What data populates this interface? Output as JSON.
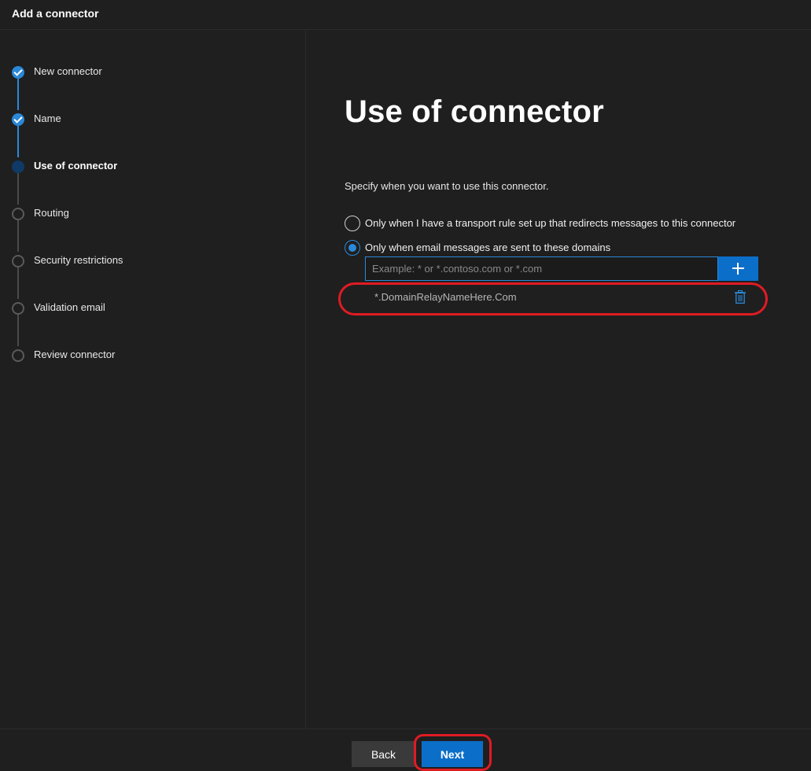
{
  "window": {
    "title": "Add a connector"
  },
  "steps": [
    {
      "label": "New connector",
      "status": "completed"
    },
    {
      "label": "Name",
      "status": "completed"
    },
    {
      "label": "Use of connector",
      "status": "current"
    },
    {
      "label": "Routing",
      "status": "pending"
    },
    {
      "label": "Security restrictions",
      "status": "pending"
    },
    {
      "label": "Validation email",
      "status": "pending"
    },
    {
      "label": "Review connector",
      "status": "pending"
    }
  ],
  "main": {
    "title": "Use of connector",
    "instructions": "Specify when you want to use this connector.",
    "options": [
      {
        "label": "Only when I have a transport rule set up that redirects messages to this connector",
        "checked": false
      },
      {
        "label": "Only when email messages are sent to these domains",
        "checked": true
      }
    ],
    "domain_input": {
      "placeholder": "Example: * or *.contoso.com or *.com",
      "value": ""
    },
    "add_button_icon": "plus-icon",
    "domains": [
      "*.DomainRelayNameHere.Com"
    ],
    "delete_icon": "trash-icon"
  },
  "footer": {
    "back_label": "Back",
    "next_label": "Next"
  },
  "colors": {
    "background": "#1f1f1f",
    "accent": "#0b6fc9",
    "accent_light": "#2b88d8",
    "annotation": "#e01b24"
  }
}
